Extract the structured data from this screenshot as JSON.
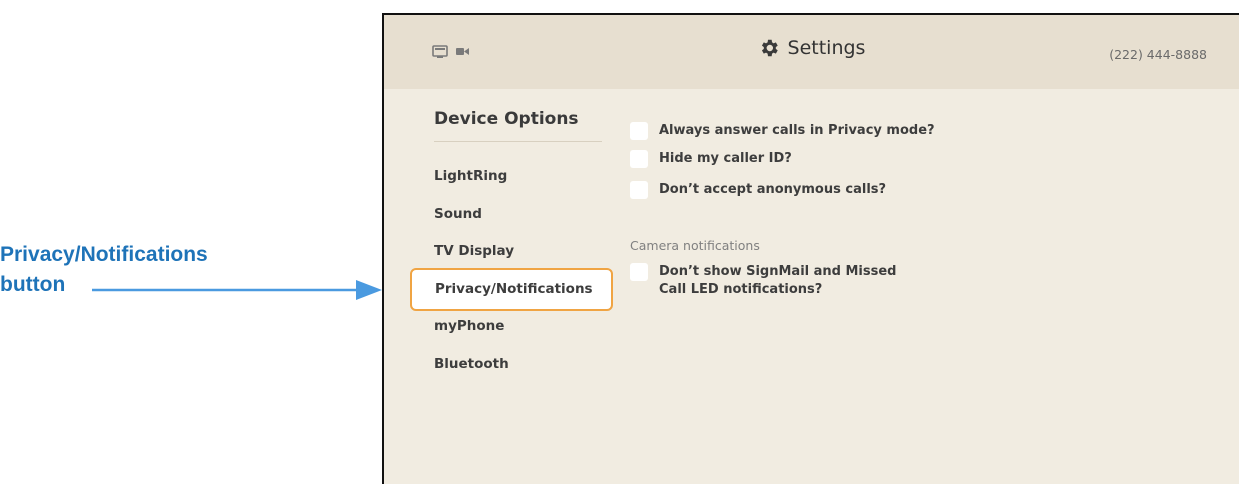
{
  "annotation": {
    "line1": "Privacy/Notifications",
    "line2": "button",
    "color": "#1e73b8"
  },
  "header": {
    "left_icons": [
      "tv-icon",
      "video-camera-icon"
    ],
    "title_icon": "gear-icon",
    "title": "Settings",
    "phone_number": "(222) 444-8888"
  },
  "sidebar": {
    "heading": "Device Options",
    "items": [
      {
        "label": "LightRing",
        "selected": false
      },
      {
        "label": "Sound",
        "selected": false
      },
      {
        "label": "TV Display",
        "selected": false
      },
      {
        "label": "Privacy/Notifications",
        "selected": true
      },
      {
        "label": "myPhone",
        "selected": false
      },
      {
        "label": "Bluetooth",
        "selected": false
      }
    ]
  },
  "options": [
    {
      "label": "Always answer calls in Privacy mode?",
      "checked": false
    },
    {
      "label": "Hide my caller ID?",
      "checked": false
    },
    {
      "label": "Don’t accept anonymous calls?",
      "checked": false
    }
  ],
  "camera_section": {
    "heading": "Camera notifications",
    "options": [
      {
        "label": "Don’t show SignMail and Missed Call LED notifications?",
        "checked": false
      }
    ]
  },
  "colors": {
    "background": "#f1ece1",
    "header": "#e7dfd0",
    "selection_border": "#f0a443"
  }
}
